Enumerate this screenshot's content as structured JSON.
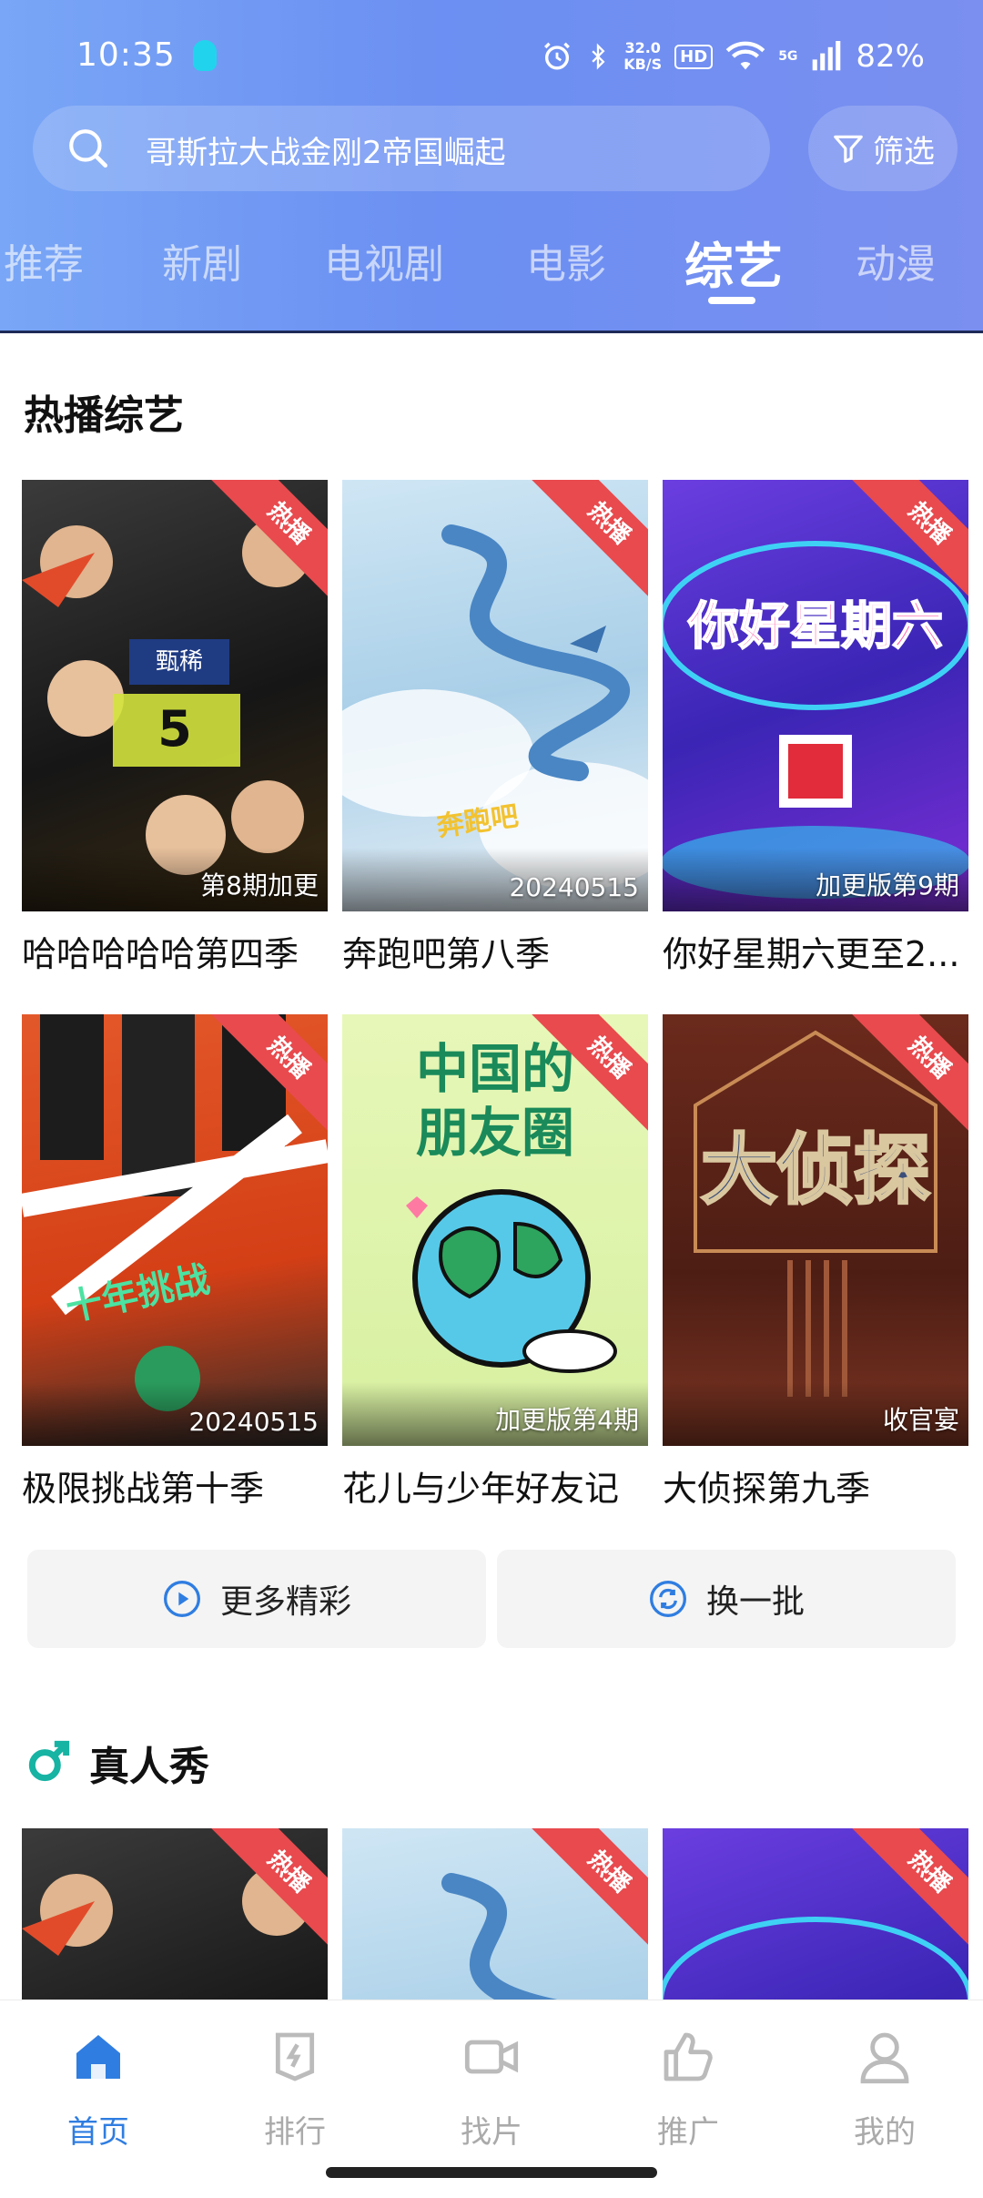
{
  "status_bar": {
    "time": "10:35",
    "speed_value": "32.0",
    "speed_unit": "KB/S",
    "hd": "HD",
    "network": "5G",
    "battery": "82%"
  },
  "search": {
    "placeholder": "哥斯拉大战金刚2帝国崛起",
    "filter_label": "筛选"
  },
  "tabs": [
    "推荐",
    "新剧",
    "电视剧",
    "电影",
    "综艺",
    "动漫"
  ],
  "active_tab": "综艺",
  "sections": [
    {
      "title": "热播综艺",
      "items": [
        {
          "title": "哈哈哈哈哈第四季",
          "badge": "热播",
          "episode": "第8期加更"
        },
        {
          "title": "奔跑吧第八季",
          "badge": "热播",
          "episode": "20240515"
        },
        {
          "title": "你好星期六更至2...",
          "badge": "热播",
          "episode": "加更版第9期"
        },
        {
          "title": "极限挑战第十季",
          "badge": "热播",
          "episode": "20240515"
        },
        {
          "title": "花儿与少年好友记",
          "badge": "热播",
          "episode": "加更版第4期"
        },
        {
          "title": "大侦探第九季",
          "badge": "热播",
          "episode": "收官宴"
        }
      ],
      "more_label": "更多精彩",
      "refresh_label": "换一批"
    },
    {
      "title": "真人秀",
      "items": [
        {
          "badge": "热播"
        },
        {
          "badge": "热播"
        },
        {
          "badge": "热播"
        }
      ]
    }
  ],
  "bottom_nav": [
    {
      "label": "首页",
      "icon": "home-icon"
    },
    {
      "label": "排行",
      "icon": "ranking-icon"
    },
    {
      "label": "找片",
      "icon": "video-camera-icon"
    },
    {
      "label": "推广",
      "icon": "thumbs-up-icon"
    },
    {
      "label": "我的",
      "icon": "user-icon"
    }
  ],
  "colors": {
    "accent": "#2f7de1",
    "hot_badge": "#e84a4e",
    "header_gradient_start": "#79a6f6",
    "header_gradient_end": "#7a8ff0"
  }
}
